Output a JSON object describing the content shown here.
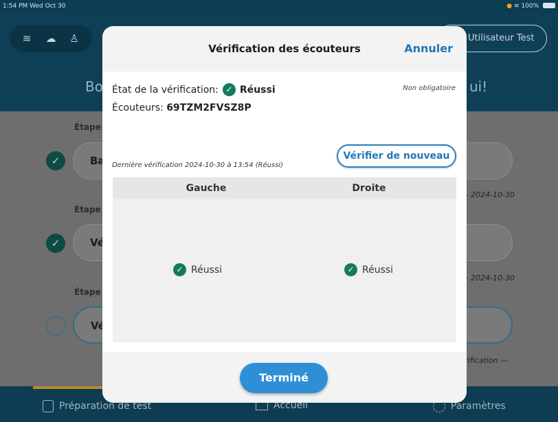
{
  "status_bar": {
    "time": "1:54 PM  Wed Oct 30",
    "battery": "100%"
  },
  "header": {
    "icons": [
      "wifi-icon",
      "cloud-upload-icon",
      "person-sync-icon"
    ],
    "user_label": "Utilisateur Test",
    "welcome_left": "Bo",
    "welcome_right": "ui!"
  },
  "steps": [
    {
      "label": "Étape",
      "button": "Ba",
      "done": true,
      "date": "2024-10-30"
    },
    {
      "label": "Étape",
      "button": "Vé",
      "done": true,
      "date": "2024-10-30"
    },
    {
      "label": "Étape",
      "button": "Vé",
      "done": false,
      "date": "rification —"
    }
  ],
  "footer": {
    "prep": "Préparation de test",
    "home": "Accueil",
    "settings": "Paramètres"
  },
  "modal": {
    "title": "Vérification des écouteurs",
    "cancel": "Annuler",
    "etat_label": "État de la vérification:",
    "etat_value": "Réussi",
    "optional": "Non obligatoire",
    "ecouteurs_label": "Écouteurs:",
    "ecouteurs_value": "69TZM2FVSZ8P",
    "last_check": "Dernière vérification 2024-10-30 à 13:54 (Réussi)",
    "reverify": "Vérifier de nouveau",
    "table": {
      "left_header": "Gauche",
      "right_header": "Droite",
      "left_result": "Réussi",
      "right_result": "Réussi"
    },
    "done": "Terminé"
  },
  "colors": {
    "accent": "#2277b5",
    "success": "#137a5f",
    "header": "#0f3f56"
  }
}
